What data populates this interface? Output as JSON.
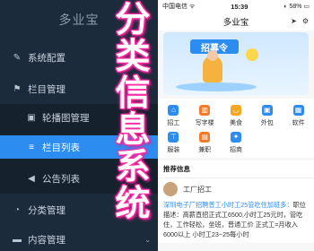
{
  "sidebar": {
    "brand": "多业宝",
    "items": [
      {
        "label": "系统配置",
        "icon": "wrench-icon"
      },
      {
        "label": "栏目管理",
        "icon": "flag-icon"
      },
      {
        "label": "轮播图管理",
        "icon": "image-icon"
      },
      {
        "label": "栏目列表",
        "icon": "list-icon"
      },
      {
        "label": "公告列表",
        "icon": "megaphone-icon"
      },
      {
        "label": "分类管理",
        "icon": "pie-chart-icon"
      },
      {
        "label": "内容管理",
        "icon": "folder-icon"
      }
    ],
    "active_index": 3
  },
  "overlay_title": [
    "分",
    "类",
    "信",
    "息",
    "系",
    "统"
  ],
  "phone": {
    "status": {
      "carrier": "中国电信 ᯤ",
      "time": "15:39",
      "battery": "◐ 58% ▭"
    },
    "navbar_title": "多业宝",
    "banner_text": "招募令",
    "categories_row1": [
      {
        "label": "招工",
        "color": "#2d8cf0",
        "icon": "house-icon"
      },
      {
        "label": "写字楼",
        "color": "#f07b2d",
        "icon": "building-icon"
      },
      {
        "label": "美食",
        "color": "#f5a623",
        "icon": "bowl-icon"
      },
      {
        "label": "外包",
        "color": "#2d8cf0",
        "icon": "box-icon"
      },
      {
        "label": "软件",
        "color": "#2d8cf0",
        "icon": "app-icon"
      }
    ],
    "categories_row2": [
      {
        "label": "服装",
        "color": "#2d8cf0",
        "icon": "shirt-icon"
      },
      {
        "label": "兼职",
        "color": "#f07b2d",
        "icon": "briefcase-icon"
      },
      {
        "label": "招商",
        "color": "#2d8cf0",
        "icon": "handshake-icon"
      }
    ],
    "section_title": "推荐信息",
    "post": {
      "author": "工厂招工",
      "text_highlight": "深圳电子厂招聘普工小时工25管吃住加班多：",
      "text_body": "职位描述：高薪直招正式工6500,小时工25元时，管吃住，工作轻松，坐班，普通工价 正式工=月收入6000以上 小时工23~25每小时"
    }
  }
}
